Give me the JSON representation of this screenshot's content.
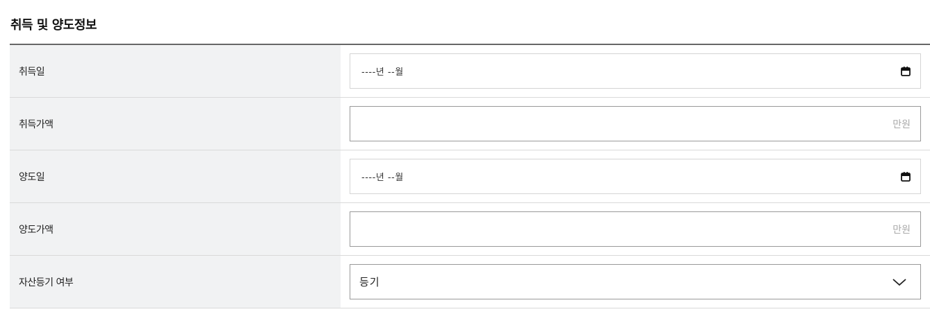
{
  "section": {
    "title": "취득 및 양도정보"
  },
  "rows": [
    {
      "label": "취득일",
      "type": "date",
      "value": "----년 --월"
    },
    {
      "label": "취득가액",
      "type": "money",
      "unit": "만원"
    },
    {
      "label": "양도일",
      "type": "date",
      "value": "----년 --월"
    },
    {
      "label": "양도가액",
      "type": "money",
      "unit": "만원"
    },
    {
      "label": "자산등기 여부",
      "type": "select",
      "value": "등기"
    }
  ],
  "icons": {
    "date_picker": "calendar-icon",
    "select_toggle": "chevron-down-icon"
  }
}
